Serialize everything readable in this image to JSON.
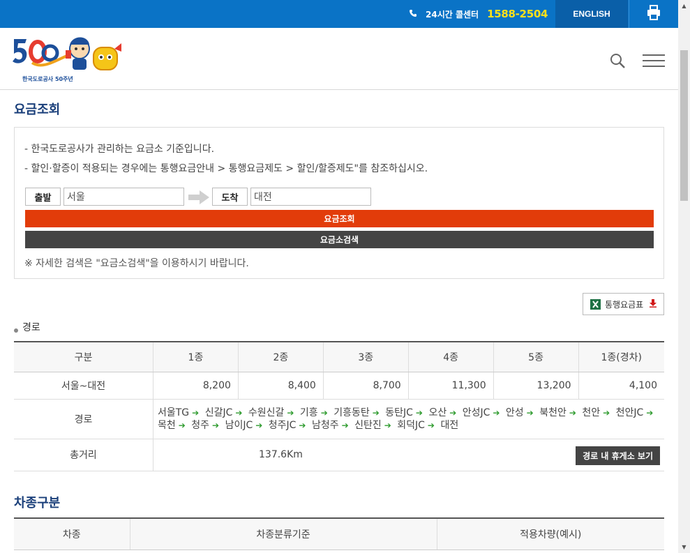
{
  "topbar": {
    "callcenter_label": "24시간 콜센터",
    "callcenter_number": "1588-2504",
    "english_label": "ENGLISH",
    "print_icon": "printer-icon"
  },
  "header": {
    "logo_caption": "한국도로공사 50주년"
  },
  "page_title": "요금조회",
  "notes": [
    "- 한국도로공사가 관리하는 요금소 기준입니다.",
    "- 할인·할증이 적용되는 경우에는 통행요금안내 > 통행요금제도 > 할인/할증제도\"를 참조하십시오."
  ],
  "search_form": {
    "depart_label": "출발",
    "depart_value": "서울",
    "arrive_label": "도착",
    "arrive_value": "대전",
    "fee_button": "요금조회",
    "tollgate_button": "요금소검색",
    "hint": "※ 자세한 검색은 \"요금소검색\"을 이용하시기 바랍니다."
  },
  "toll_table_button": "통행요금표",
  "route_section_title": "경로",
  "fare_table": {
    "headers": [
      "구분",
      "1종",
      "2종",
      "3종",
      "4종",
      "5종",
      "1종(경차)"
    ],
    "fare_row": {
      "label": "서울~대전",
      "values": [
        "8,200",
        "8,400",
        "8,700",
        "11,300",
        "13,200",
        "4,100"
      ]
    },
    "route_row": {
      "label": "경로",
      "stops": [
        "서울TG",
        "신갈JC",
        "수원신갈",
        "기흥",
        "기흥동탄",
        "동탄JC",
        "오산",
        "안성JC",
        "안성",
        "북천안",
        "천안",
        "천안JC",
        "목천",
        "청주",
        "남이JC",
        "청주JC",
        "남청주",
        "신탄진",
        "회덕JC",
        "대전"
      ]
    },
    "distance_row": {
      "label": "총거리",
      "value": "137.6Km",
      "rest_button": "경로 내 휴게소 보기"
    }
  },
  "vehicle_section_title": "차종구분",
  "vehicle_table": {
    "headers": [
      "차종",
      "차종분류기준",
      "적용차량(예시)"
    ]
  }
}
